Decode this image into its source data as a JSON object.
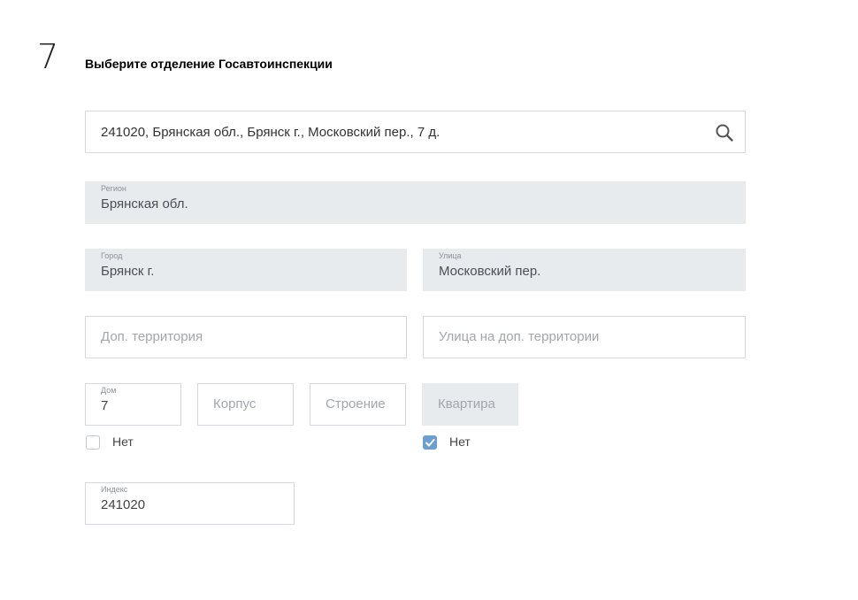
{
  "step": {
    "number": "7",
    "title": "Выберите отделение Госавтоинспекции"
  },
  "search": {
    "value": "241020, Брянская обл., Брянск г., Московский пер., 7 д.",
    "icon": "search-icon"
  },
  "region": {
    "label": "Регион",
    "value": "Брянская обл."
  },
  "city": {
    "label": "Город",
    "value": "Брянск г."
  },
  "street": {
    "label": "Улица",
    "value": "Московский пер."
  },
  "extra_territory": {
    "placeholder": "Доп. территория"
  },
  "extra_street": {
    "placeholder": "Улица на доп. территории"
  },
  "house": {
    "label": "Дом",
    "value": "7"
  },
  "building": {
    "placeholder": "Корпус"
  },
  "structure": {
    "placeholder": "Строение"
  },
  "apartment": {
    "placeholder": "Квартира"
  },
  "no_house_checkbox": {
    "label": "Нет",
    "checked": false
  },
  "no_apartment_checkbox": {
    "label": "Нет",
    "checked": true
  },
  "index": {
    "label": "Индекс",
    "value": "241020"
  },
  "colors": {
    "filled_bg": "#e8ebee",
    "border": "#d5d8dc",
    "check_accent": "#6a9fd0"
  }
}
